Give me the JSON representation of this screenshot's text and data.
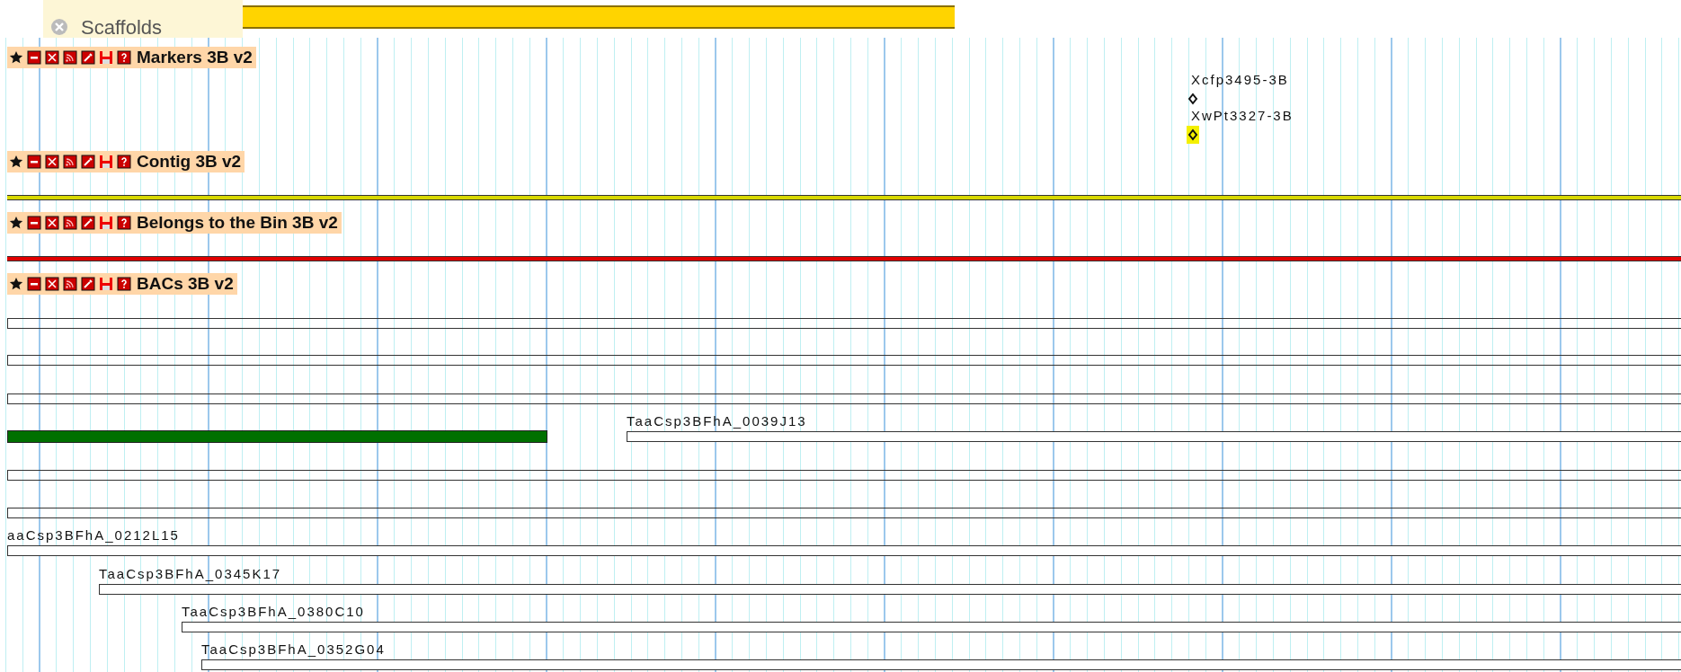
{
  "header": {
    "title": "Scaffolds"
  },
  "tracks": [
    {
      "name": "Markers 3B v2",
      "kind": "markers",
      "features": [
        {
          "label": "Xcfp3495-3B",
          "highlighted": false
        },
        {
          "label": "XwPt3327-3B",
          "highlighted": true
        }
      ]
    },
    {
      "name": "Contig 3B v2",
      "kind": "line",
      "color": "#d8d800"
    },
    {
      "name": "Belongs to the Bin 3B v2",
      "kind": "line",
      "color": "#e00000"
    },
    {
      "name": "BACs 3B v2",
      "kind": "boxes",
      "features": [
        {
          "kind": "box"
        },
        {
          "kind": "box"
        },
        {
          "kind": "box"
        },
        {
          "kind": "bar",
          "color": "#007000"
        },
        {
          "kind": "box",
          "label": "TaaCsp3BFhA_0039J13"
        },
        {
          "kind": "box"
        },
        {
          "kind": "box"
        },
        {
          "kind": "box",
          "label": "aaCsp3BFhA_0212L15"
        },
        {
          "kind": "box",
          "label": "TaaCsp3BFhA_0345K17"
        },
        {
          "kind": "box",
          "label": "TaaCsp3BFhA_0380C10"
        },
        {
          "kind": "box",
          "label": "TaaCsp3BFhA_0352G04"
        }
      ]
    }
  ]
}
